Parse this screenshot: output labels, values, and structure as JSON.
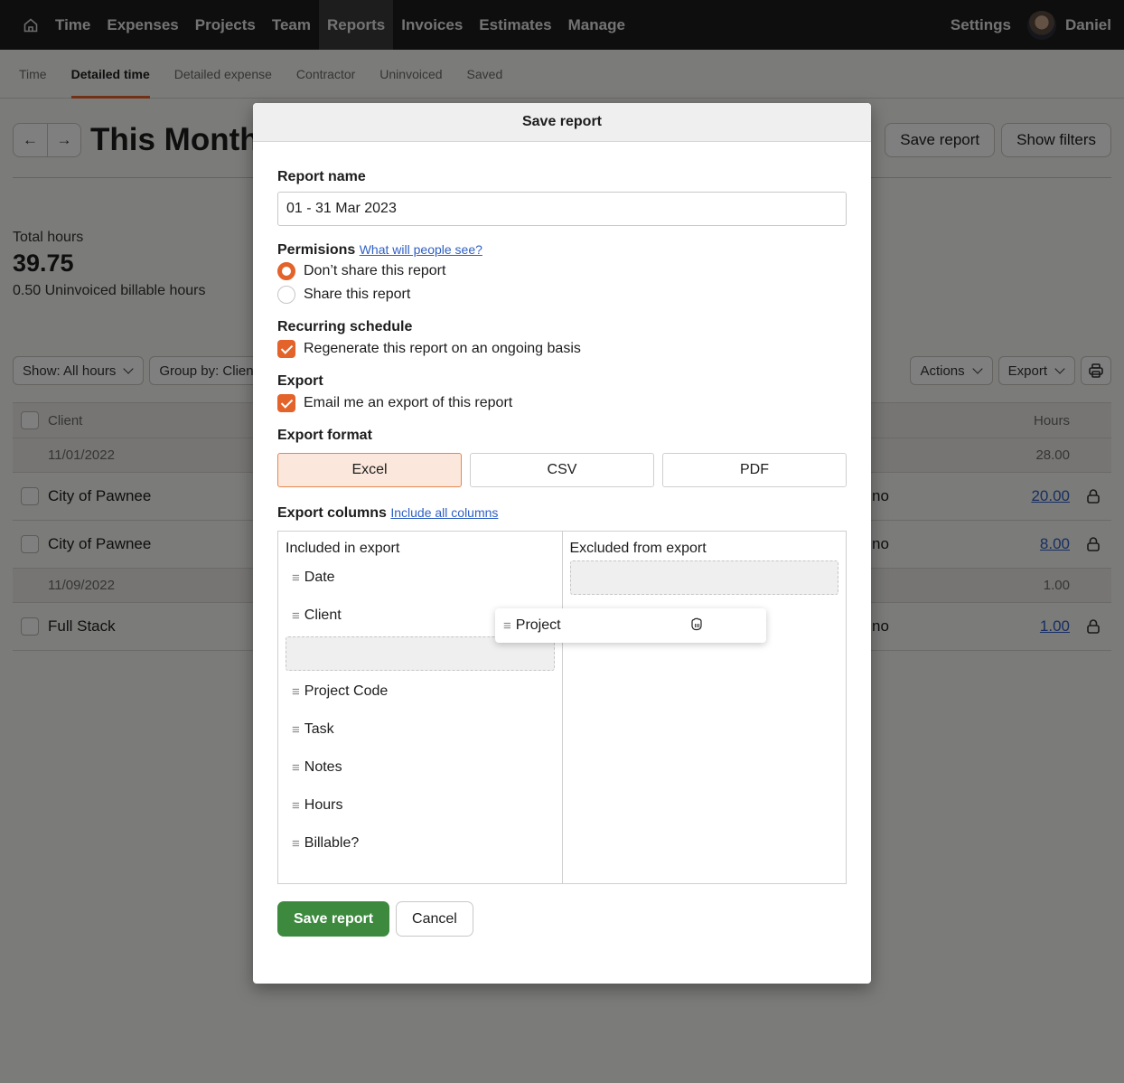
{
  "topnav": {
    "home_icon": "home-icon",
    "items": [
      "Time",
      "Expenses",
      "Projects",
      "Team",
      "Reports",
      "Invoices",
      "Estimates",
      "Manage"
    ],
    "active": "Reports",
    "settings": "Settings",
    "user_name": "Daniel"
  },
  "subnav": {
    "tabs": [
      "Time",
      "Detailed time",
      "Detailed expense",
      "Contractor",
      "Uninvoiced",
      "Saved"
    ],
    "active": "Detailed time"
  },
  "header": {
    "prev_icon": "arrow-left-icon",
    "next_icon": "arrow-right-icon",
    "title": "This Month",
    "save_report": "Save report",
    "show_filters": "Show filters"
  },
  "stats": {
    "total_label": "Total hours",
    "total_value": "39.75",
    "uninvoiced": "0.50 Uninvoiced billable hours"
  },
  "toolbar": {
    "show": "Show: All hours",
    "group_by": "Group by: Client",
    "actions": "Actions",
    "export": "Export",
    "print_icon": "printer-icon"
  },
  "table": {
    "headers": {
      "client": "Client",
      "hours": "Hours"
    },
    "rows": [
      {
        "type": "group",
        "label": "11/01/2022",
        "hours": "28.00"
      },
      {
        "type": "entry",
        "client": "City of Pawnee",
        "billable": "no",
        "hours": "20.00",
        "locked": true
      },
      {
        "type": "entry",
        "client": "City of Pawnee",
        "billable": "no",
        "hours": "8.00",
        "locked": true
      },
      {
        "type": "group",
        "label": "11/09/2022",
        "hours": "1.00"
      },
      {
        "type": "entry",
        "client": "Full Stack",
        "billable": "no",
        "hours": "1.00",
        "locked": true
      }
    ]
  },
  "modal": {
    "title": "Save report",
    "report_name_label": "Report name",
    "report_name_value": "01 - 31 Mar 2023",
    "permissions_label": "Permisions",
    "permissions_link": "What will people see?",
    "permission_options": [
      {
        "label": "Don’t share this report",
        "selected": true
      },
      {
        "label": "Share this report",
        "selected": false
      }
    ],
    "recurring_label": "Recurring schedule",
    "recurring_option": {
      "label": "Regenerate this report on an ongoing basis",
      "checked": true
    },
    "export_label": "Export",
    "export_option": {
      "label": "Email me an export of this report",
      "checked": true
    },
    "format_label": "Export format",
    "formats": [
      {
        "label": "Excel",
        "selected": true
      },
      {
        "label": "CSV",
        "selected": false
      },
      {
        "label": "PDF",
        "selected": false
      }
    ],
    "columns_label": "Export columns",
    "columns_link": "Include all columns",
    "included_title": "Included in export",
    "included": [
      "Date",
      "Client",
      "Project Code",
      "Task",
      "Notes",
      "Hours",
      "Billable?"
    ],
    "excluded_title": "Excluded from export",
    "excluded": [],
    "dragging_item": "Project",
    "save_button": "Save report",
    "cancel_button": "Cancel"
  },
  "colors": {
    "accent": "#e3632a",
    "primary_button": "#3d8a3f",
    "link": "#2f5fc4",
    "nav_bg": "#1d1d1d"
  }
}
